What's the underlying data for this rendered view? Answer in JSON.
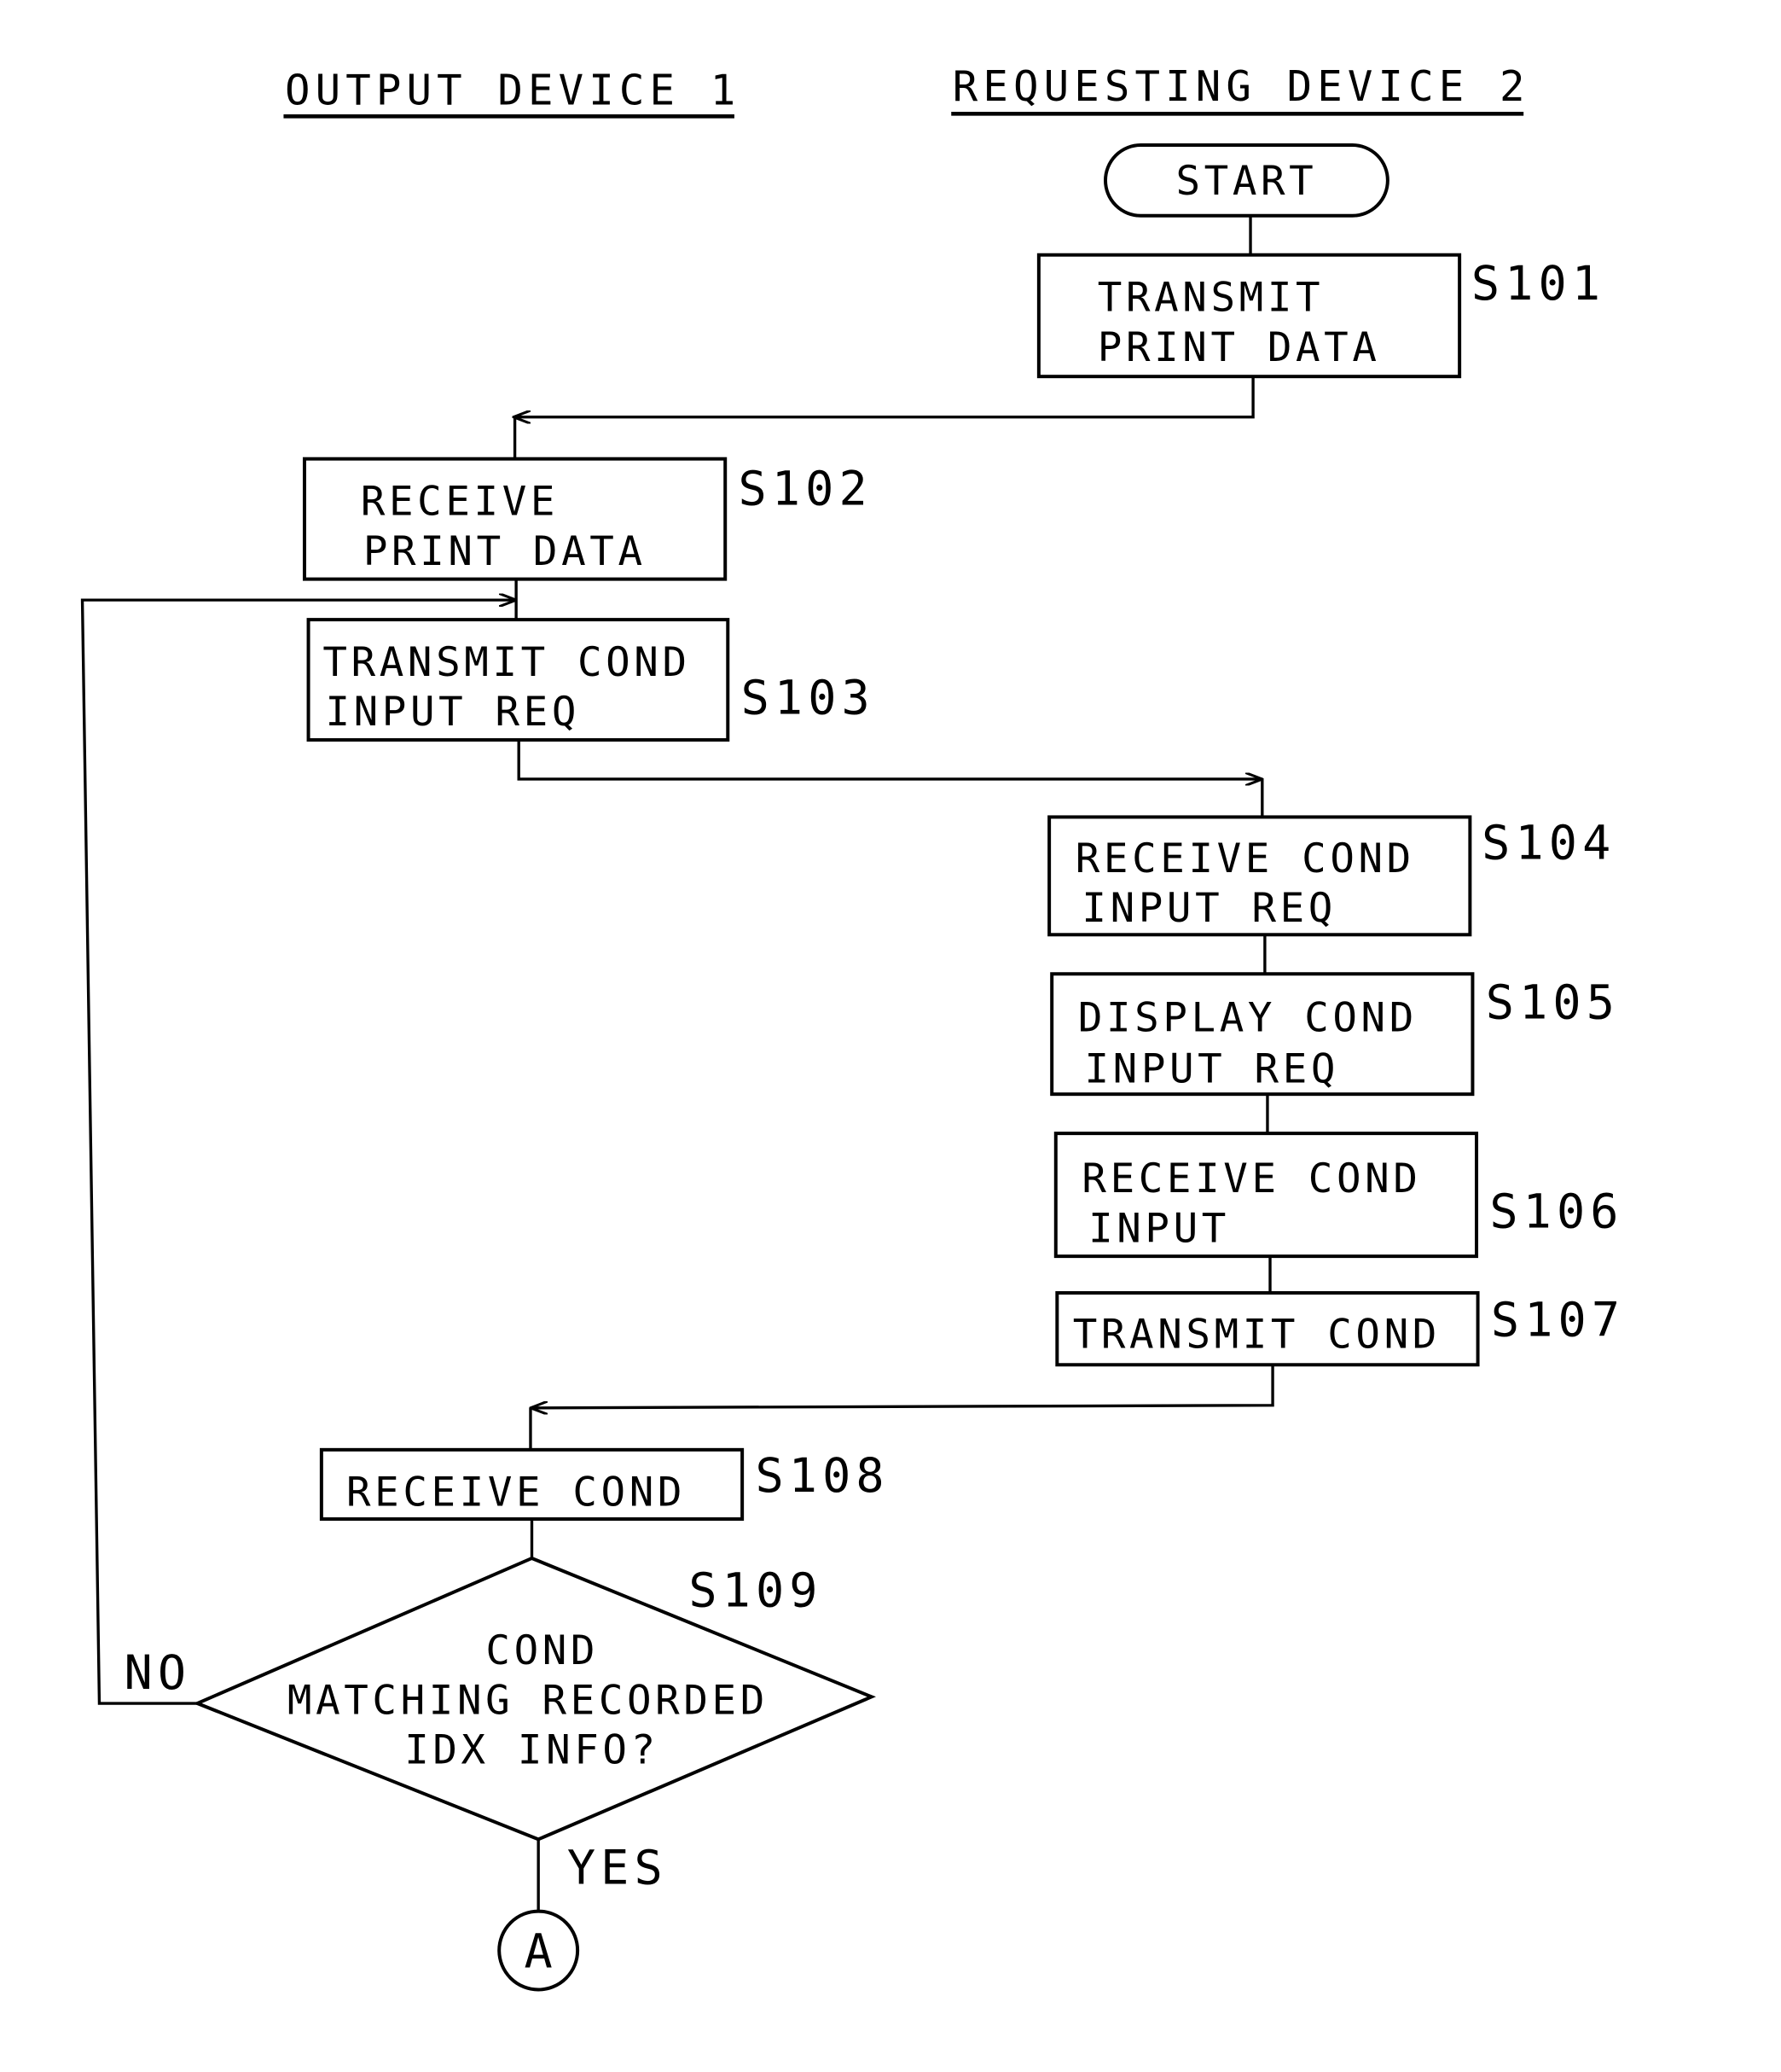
{
  "lanes": {
    "left": "OUTPUT DEVICE 1",
    "right": "REQUESTING DEVICE 2"
  },
  "start": "START",
  "steps": {
    "s101": {
      "id": "S101",
      "lines": [
        "TRANSMIT",
        "PRINT DATA"
      ]
    },
    "s102": {
      "id": "S102",
      "lines": [
        "RECEIVE",
        "PRINT DATA"
      ]
    },
    "s103": {
      "id": "S103",
      "lines": [
        "TRANSMIT COND",
        "INPUT REQ"
      ]
    },
    "s104": {
      "id": "S104",
      "lines": [
        "RECEIVE COND",
        "INPUT REQ"
      ]
    },
    "s105": {
      "id": "S105",
      "lines": [
        "DISPLAY COND",
        "INPUT REQ"
      ]
    },
    "s106": {
      "id": "S106",
      "lines": [
        "RECEIVE COND",
        "INPUT"
      ]
    },
    "s107": {
      "id": "S107",
      "lines": [
        "TRANSMIT COND"
      ]
    },
    "s108": {
      "id": "S108",
      "lines": [
        "RECEIVE COND"
      ]
    }
  },
  "decision": {
    "id": "S109",
    "lines": [
      "COND",
      "MATCHING RECORDED",
      "IDX INFO?"
    ],
    "no_label": "NO",
    "yes_label": "YES"
  },
  "connector": "A"
}
